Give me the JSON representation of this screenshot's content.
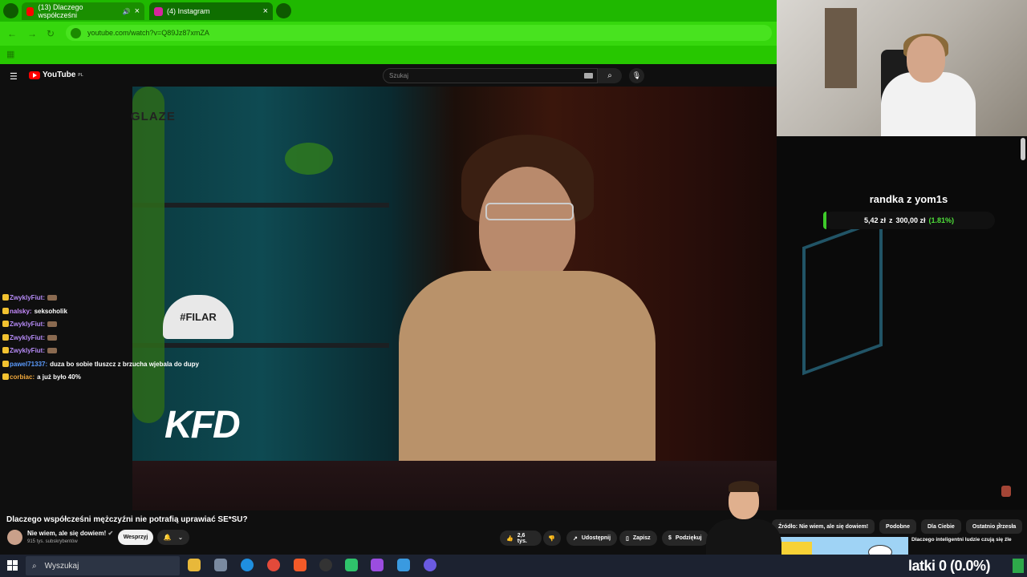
{
  "browser": {
    "tabs": [
      {
        "label": "(13) Dlaczego współcześni",
        "active": true
      },
      {
        "label": "(4) Instagram",
        "active": false
      }
    ],
    "url": "youtube.com/watch?v=Q89Jz87xmZA",
    "tab_close": "×"
  },
  "youtube": {
    "logo": "YouTube",
    "region": "PL",
    "search_placeholder": "Szukaj",
    "video_title": "Dlaczego współcześni mężczyźni nie potrafią uprawiać SE*SU?",
    "channel_name": "Nie wiem, ale się dowiem!",
    "channel_subs": "915 tys. subskrybentów",
    "support_label": "Wesprzyj",
    "like_count": "2,6 tys.",
    "share_label": "Udostępnij",
    "save_label": "Zapisz",
    "thanks_label": "Podziękuj",
    "chips": [
      "Źródło: Nie wiem, ale się dowiem!",
      "Podobne",
      "Dla Ciebie",
      "Ostatnio przesła"
    ],
    "rec_title": "Dlaczego inteligentni ludzie czują się źle",
    "video_overlay": {
      "cap_text": "#FILAR",
      "logo_text": "KFD"
    }
  },
  "chat": [
    {
      "user": "ZwyklyFiut:",
      "user_color": "#b58af5",
      "text": "",
      "emote": true
    },
    {
      "user": "nalsky:",
      "user_color": "#c78cff",
      "text": "seksoholik",
      "emote": false
    },
    {
      "user": "ZwyklyFiut:",
      "user_color": "#b58af5",
      "text": "",
      "emote": true
    },
    {
      "user": "ZwyklyFiut:",
      "user_color": "#b58af5",
      "text": "",
      "emote": true
    },
    {
      "user": "ZwyklyFiut:",
      "user_color": "#b58af5",
      "text": "",
      "emote": true
    },
    {
      "user": "pawel71337:",
      "user_color": "#5b9cff",
      "text": "duza bo sobie tluszcz z brzucha wjebala do dupy",
      "emote": false
    },
    {
      "user": "corbiac:",
      "user_color": "#f0a83c",
      "text": "a już było 40%",
      "emote": false
    }
  ],
  "donation": {
    "title": "randka z yom1s",
    "current": "5,42 zł",
    "connector": "z",
    "goal": "300,00 zł",
    "percent_text": "(1.81%)",
    "progress": 0.0181
  },
  "webcam": {
    "shirt_text": "GLAZE"
  },
  "taskbar": {
    "search_label": "Wyszukaj",
    "counter_text": "latki 0 (0.0%)"
  },
  "colors": {
    "chrome_green": "#22c800",
    "yt_red": "#ff0000",
    "donation_green": "#3ecb2a"
  }
}
